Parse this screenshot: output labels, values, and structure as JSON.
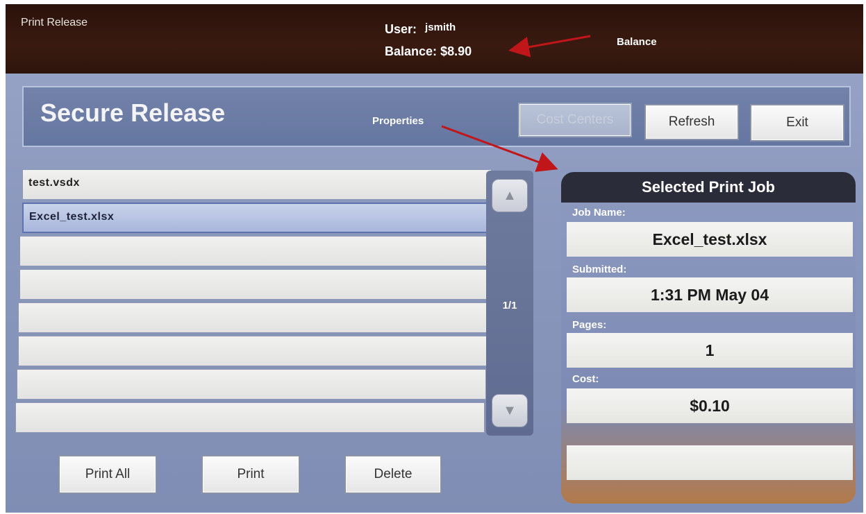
{
  "app": {
    "title": "Print Release",
    "user_label": "User:",
    "user_value": "jsmith",
    "balance_label": "Balance:",
    "balance_value": "$8.90"
  },
  "annotations": {
    "balance": "Balance",
    "properties": "Properties",
    "arrow_color": "#c0161a"
  },
  "header": {
    "title": "Secure Release",
    "buttons": {
      "cost_centers": "Cost Centers",
      "refresh": "Refresh",
      "exit": "Exit"
    }
  },
  "jobs": {
    "rows": [
      "test.vsdx",
      "Excel_test.xlsx",
      "",
      "",
      "",
      "",
      "",
      ""
    ],
    "selected_index": 1,
    "page_indicator": "1/1",
    "scroll_up_icon": "triangle-up",
    "scroll_down_icon": "triangle-down"
  },
  "actions": {
    "print_all": "Print All",
    "print": "Print",
    "delete": "Delete"
  },
  "selected_job": {
    "title": "Selected Print Job",
    "job_name_label": "Job Name:",
    "job_name": "Excel_test.xlsx",
    "submitted_label": "Submitted:",
    "submitted": "1:31 PM May 04",
    "pages_label": "Pages:",
    "pages": "1",
    "cost_label": "Cost:",
    "cost": "$0.10"
  }
}
